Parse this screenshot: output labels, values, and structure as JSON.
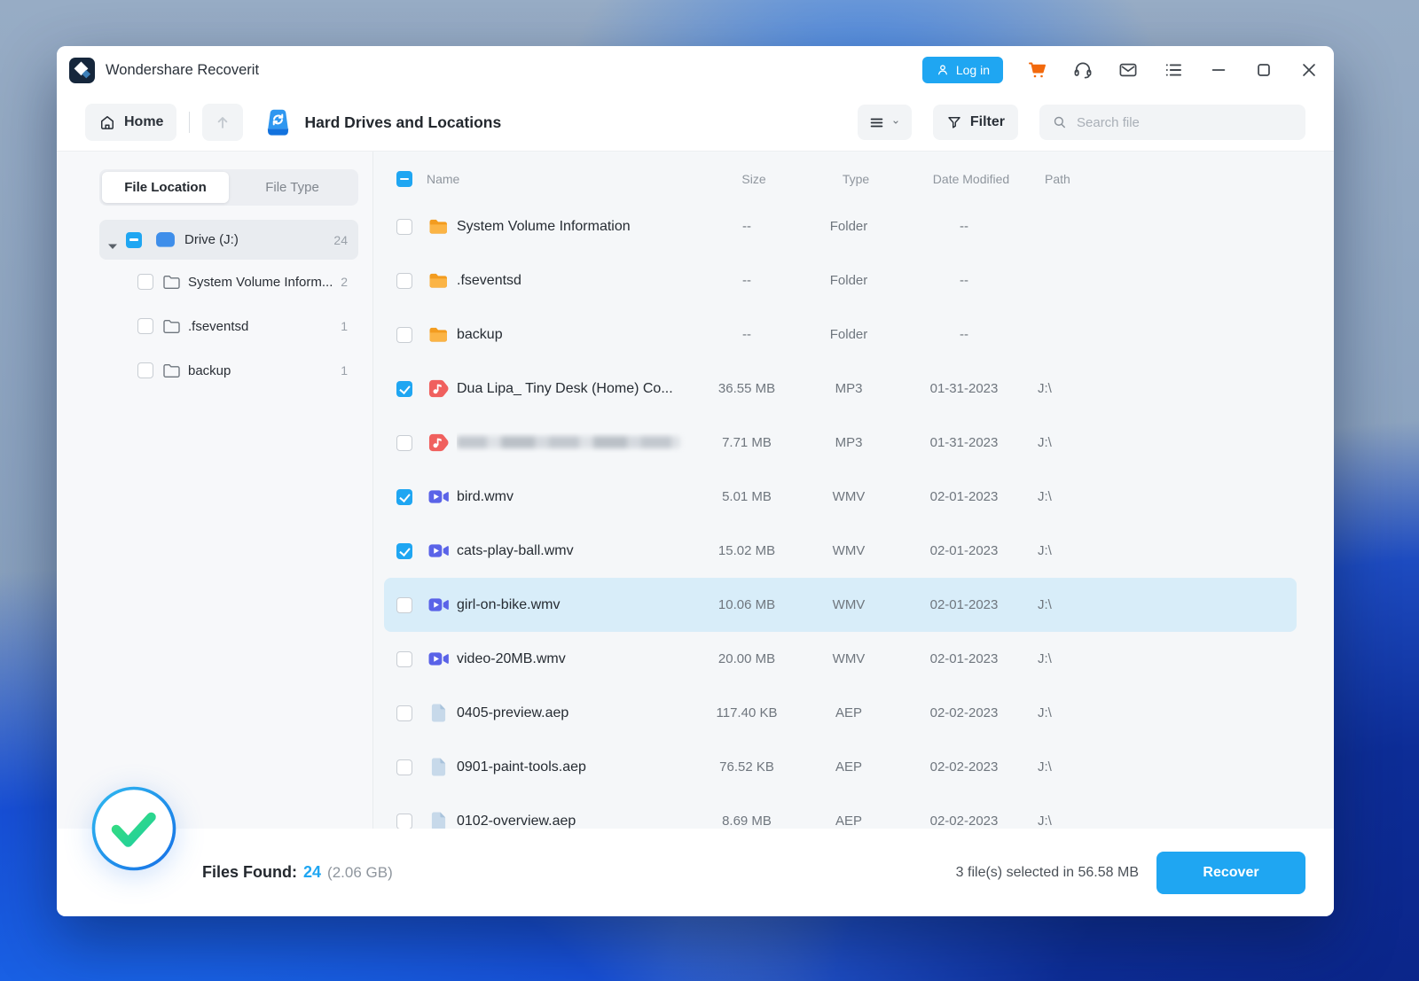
{
  "colors": {
    "accent": "#1FA6F2",
    "cart": "#F2690D",
    "folder": "#F39C1F",
    "folder_light": "#FBB445",
    "audio": "#F0605E",
    "video": "#5A63E8",
    "doc": "#C7D9EA",
    "doc_fold": "#A9C3DC",
    "drive": "#3E8EEA",
    "highlight": "#D8EDF9",
    "green1": "#36DC7E",
    "green2": "#1FCFA0",
    "ring1": "#2FB9F0",
    "ring2": "#1670E6"
  },
  "titlebar": {
    "title": "Wondershare Recoverit",
    "login_label": "Log in"
  },
  "toolbar": {
    "home_label": "Home",
    "page_title": "Hard Drives and Locations",
    "filter_label": "Filter",
    "search_placeholder": "Search file"
  },
  "sidebar": {
    "tabs": [
      {
        "label": "File Location"
      },
      {
        "label": "File Type"
      }
    ],
    "tree": {
      "root": {
        "label": "Drive (J:)",
        "count": "24",
        "checkbox": "indeterminate",
        "expanded": true
      },
      "children": [
        {
          "label": "System Volume Inform...",
          "count": "2",
          "checkbox": "unchecked"
        },
        {
          "label": ".fseventsd",
          "count": "1",
          "checkbox": "unchecked"
        },
        {
          "label": "backup",
          "count": "1",
          "checkbox": "unchecked"
        }
      ]
    }
  },
  "table": {
    "select_all_state": "indeterminate",
    "columns": [
      "Name",
      "Size",
      "Type",
      "Date Modified",
      "Path"
    ],
    "rows": [
      {
        "name": "System Volume Information",
        "size": "--",
        "type": "Folder",
        "date": "--",
        "path": "",
        "icon": "folder",
        "checked": false,
        "highlighted": false,
        "blurred": false
      },
      {
        "name": ".fseventsd",
        "size": "--",
        "type": "Folder",
        "date": "--",
        "path": "",
        "icon": "folder",
        "checked": false,
        "highlighted": false,
        "blurred": false
      },
      {
        "name": "backup",
        "size": "--",
        "type": "Folder",
        "date": "--",
        "path": "",
        "icon": "folder",
        "checked": false,
        "highlighted": false,
        "blurred": false
      },
      {
        "name": "Dua Lipa_ Tiny Desk (Home) Co...",
        "size": "36.55 MB",
        "type": "MP3",
        "date": "01-31-2023",
        "path": "J:\\",
        "icon": "audio",
        "checked": true,
        "highlighted": false,
        "blurred": false
      },
      {
        "name": "",
        "size": "7.71 MB",
        "type": "MP3",
        "date": "01-31-2023",
        "path": "J:\\",
        "icon": "audio",
        "checked": false,
        "highlighted": false,
        "blurred": true
      },
      {
        "name": "bird.wmv",
        "size": "5.01 MB",
        "type": "WMV",
        "date": "02-01-2023",
        "path": "J:\\",
        "icon": "video",
        "checked": true,
        "highlighted": false,
        "blurred": false
      },
      {
        "name": "cats-play-ball.wmv",
        "size": "15.02 MB",
        "type": "WMV",
        "date": "02-01-2023",
        "path": "J:\\",
        "icon": "video",
        "checked": true,
        "highlighted": false,
        "blurred": false
      },
      {
        "name": "girl-on-bike.wmv",
        "size": "10.06 MB",
        "type": "WMV",
        "date": "02-01-2023",
        "path": "J:\\",
        "icon": "video",
        "checked": false,
        "highlighted": true,
        "blurred": false
      },
      {
        "name": "video-20MB.wmv",
        "size": "20.00 MB",
        "type": "WMV",
        "date": "02-01-2023",
        "path": "J:\\",
        "icon": "video",
        "checked": false,
        "highlighted": false,
        "blurred": false
      },
      {
        "name": "0405-preview.aep",
        "size": "117.40 KB",
        "type": "AEP",
        "date": "02-02-2023",
        "path": "J:\\",
        "icon": "document",
        "checked": false,
        "highlighted": false,
        "blurred": false
      },
      {
        "name": "0901-paint-tools.aep",
        "size": "76.52 KB",
        "type": "AEP",
        "date": "02-02-2023",
        "path": "J:\\",
        "icon": "document",
        "checked": false,
        "highlighted": false,
        "blurred": false
      },
      {
        "name": "0102-overview.aep",
        "size": "8.69 MB",
        "type": "AEP",
        "date": "02-02-2023",
        "path": "J:\\",
        "icon": "document",
        "checked": false,
        "highlighted": false,
        "blurred": false
      }
    ]
  },
  "footer": {
    "files_found_label": "Files Found:",
    "files_found_count": "24",
    "files_found_size": "(2.06 GB)",
    "selection_text": "3 file(s) selected in 56.58 MB",
    "recover_label": "Recover"
  }
}
